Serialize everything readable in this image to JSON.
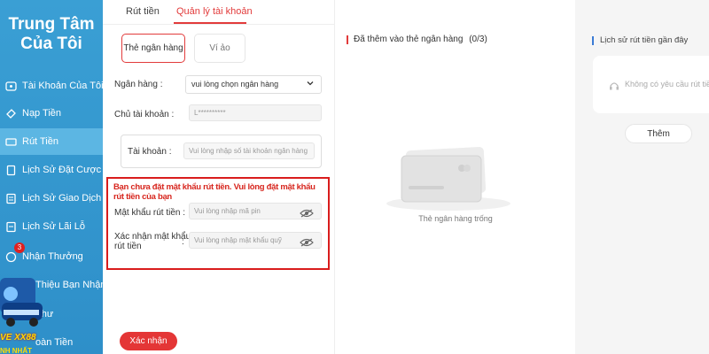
{
  "sidebar": {
    "title_line1": "Trung Tâm",
    "title_line2": "Của Tôi",
    "items": [
      {
        "label": "Tài Khoản Của Tôi"
      },
      {
        "label": "Nạp Tiền"
      },
      {
        "label": "Rút Tiền"
      },
      {
        "label": "Lịch Sử Đặt Cược"
      },
      {
        "label": "Lịch Sử Giao Dịch"
      },
      {
        "label": "Lịch Sử Lãi Lỗ"
      },
      {
        "label": "Nhận Thưởng"
      },
      {
        "label": "Thiệu Bạn Nhận"
      },
      {
        "label": "Thư"
      },
      {
        "label": "oàn Tiền"
      }
    ],
    "reward_badge": "3",
    "promo_text": "VE XX88",
    "promo_text2": "NH NHẤT",
    "accent": "#3a9fd4"
  },
  "tabs": {
    "withdraw": "Rút tiền",
    "manage_account": "Quản lý tài khoản"
  },
  "subtabs": {
    "bank_card": "Thẻ ngân hàng",
    "wallet": "Ví ảo"
  },
  "form": {
    "bank_label": "Ngân hàng :",
    "bank_select_value": "vui lòng chọn ngân hàng",
    "owner_label": "Chủ tài khoản :",
    "owner_value": "L**********",
    "account_label": "Tài khoản :",
    "account_placeholder": "Vui lòng nhập số tài khoản ngân hàng",
    "warning": "Bạn chưa đặt mật khẩu rút tiền. Vui lòng đặt mật khẩu rút tiền của bạn",
    "pin_label": "Mật khẩu rút tiền :",
    "pin_placeholder": "Vui lòng nhập mã pin",
    "confirm_label_line1": "Xác nhận mật khẩu",
    "confirm_label_line2": "rút tiền",
    "confirm_colon": ":",
    "confirm_placeholder": "Vui lòng nhập mật khẩu quỹ",
    "submit": "Xác nhận",
    "accent": "#e43636"
  },
  "bank_list": {
    "title": "Đã thêm vào thẻ ngân hàng",
    "count": "(0/3)",
    "empty": "Thẻ ngân hàng trống"
  },
  "history": {
    "title": "Lịch sử rút tiền gần đây",
    "empty": "Không có yêu cầu rút tiền",
    "add_button": "Thêm"
  }
}
